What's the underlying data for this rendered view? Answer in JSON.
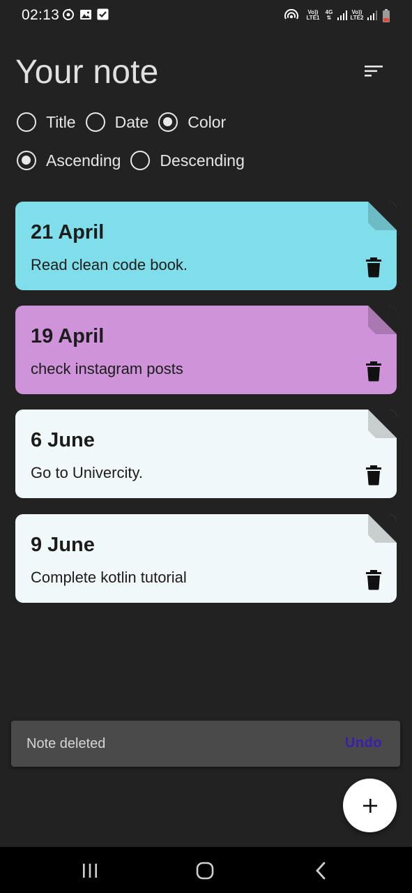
{
  "status_bar": {
    "time": "02:13",
    "icons": [
      "sync-icon",
      "image-icon",
      "checkbox-icon"
    ],
    "right_icons": [
      "hotspot-icon",
      "volte-icon",
      "4g-icon",
      "signal-icon",
      "signal-icon",
      "battery-icon"
    ],
    "sim1_line1": "Vo))",
    "sim1_line2": "LTE1",
    "net_line1": "4G",
    "sim2_line1": "Vo))",
    "sim2_line2": "LTE2"
  },
  "header": {
    "title": "Your note",
    "sort_icon": "sort-icon"
  },
  "sort_options": {
    "by": [
      {
        "label": "Title",
        "checked": false
      },
      {
        "label": "Date",
        "checked": false
      },
      {
        "label": "Color",
        "checked": true
      }
    ],
    "order": [
      {
        "label": "Ascending",
        "checked": true
      },
      {
        "label": "Descending",
        "checked": false
      }
    ]
  },
  "notes": [
    {
      "title": "21 April",
      "content": "Read clean code book.",
      "color": "#80deea",
      "fold_color": "#6cbcc6"
    },
    {
      "title": "19 April",
      "content": "check instagram posts",
      "color": "#ce93d8",
      "fold_color": "#a978b2"
    },
    {
      "title": "6 June",
      "content": "Go to Univercity.",
      "color": "#f1f8f9",
      "fold_color": "#c8cdcd"
    },
    {
      "title": "9 June",
      "content": "Complete kotlin tutorial",
      "color": "#f1f8f9",
      "fold_color": "#c8cdcd"
    }
  ],
  "snackbar": {
    "message": "Note deleted",
    "action": "Undo"
  },
  "fab": {
    "icon": "add-icon"
  },
  "nav_bar": {
    "buttons": [
      "recents-icon",
      "home-icon",
      "back-icon"
    ]
  },
  "colors": {
    "background": "#222222",
    "snackbar_bg": "#4a4a4a",
    "undo": "#3a1fb0"
  }
}
